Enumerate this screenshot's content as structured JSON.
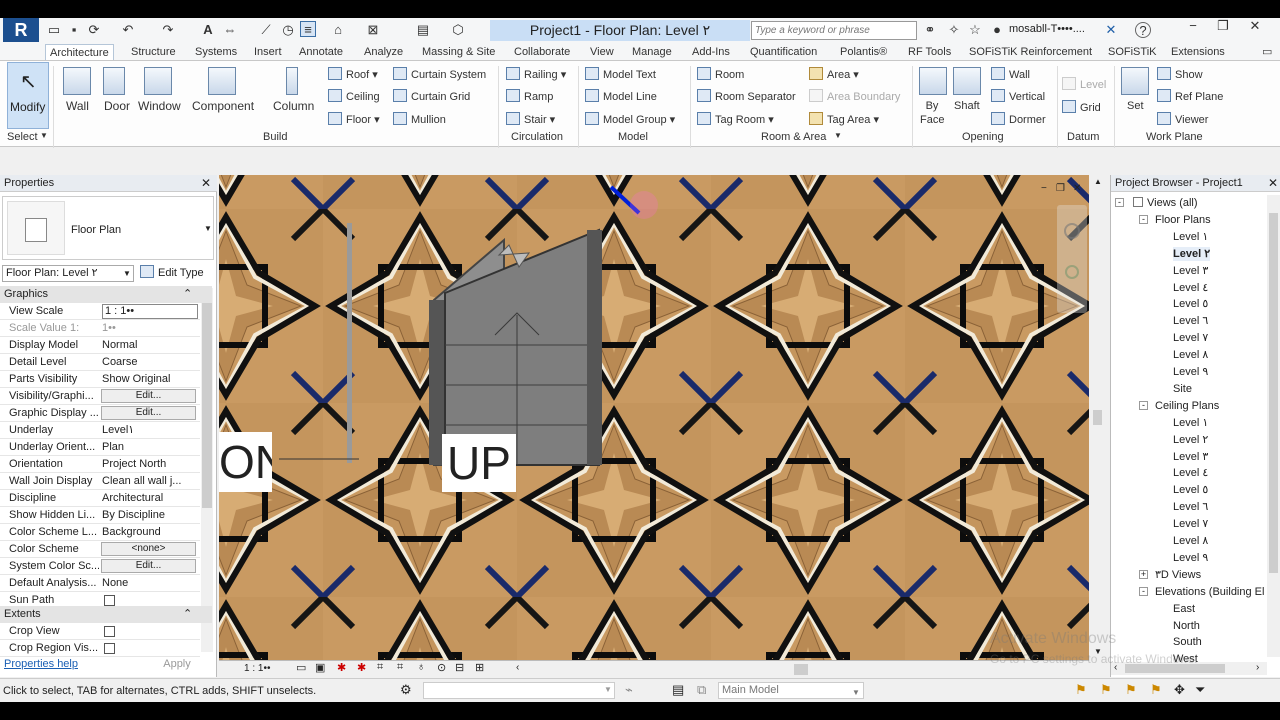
{
  "window": {
    "title": "Project1 - Floor Plan: Level ٢",
    "search_placeholder": "Type a keyword or phrase",
    "user": "mosabll-T••••...."
  },
  "tabs": [
    "Architecture",
    "Structure",
    "Systems",
    "Insert",
    "Annotate",
    "Analyze",
    "Massing & Site",
    "Collaborate",
    "View",
    "Manage",
    "Add-Ins",
    "Quantification",
    "Polantis®",
    "RF Tools",
    "SOFiSTiK Reinforcement",
    "SOFiSTiK",
    "Extensions"
  ],
  "ribbon": {
    "select": {
      "modify": "Modify",
      "select_label": "Select"
    },
    "build": {
      "label": "Build",
      "wall": "Wall",
      "door": "Door",
      "window": "Window",
      "component": "Component",
      "column": "Column",
      "roof": "Roof",
      "ceiling": "Ceiling",
      "floor": "Floor",
      "curtain_system": "Curtain System",
      "curtain_grid": "Curtain Grid",
      "mullion": "Mullion"
    },
    "circulation": {
      "label": "Circulation",
      "railing": "Railing",
      "ramp": "Ramp",
      "stair": "Stair"
    },
    "model": {
      "label": "Model",
      "model_text": "Model Text",
      "model_line": "Model Line",
      "model_group": "Model Group"
    },
    "room_area": {
      "label": "Room & Area",
      "room": "Room",
      "room_separator": "Room Separator",
      "tag_room": "Tag Room",
      "area": "Area",
      "area_boundary": "Area Boundary",
      "tag_area": "Tag Area"
    },
    "opening": {
      "label": "Opening",
      "by_face": "By Face",
      "by_face_2": "Face",
      "by": "By",
      "shaft": "Shaft",
      "wall": "Wall",
      "vertical": "Vertical",
      "dormer": "Dormer"
    },
    "datum": {
      "label": "Datum",
      "level": "Level",
      "grid": "Grid"
    },
    "work_plane": {
      "label": "Work Plane",
      "set": "Set",
      "show": "Show",
      "ref_plane": "Ref Plane",
      "viewer": "Viewer"
    }
  },
  "properties": {
    "title": "Properties",
    "type_name": "Floor Plan",
    "instance": "Floor Plan: Level ٢",
    "edit_type": "Edit Type",
    "groups": {
      "graphics": "Graphics",
      "extents": "Extents"
    },
    "rows": [
      {
        "k": "View Scale",
        "v": "1 : 1••"
      },
      {
        "k": "Scale Value    1:",
        "v": "1••"
      },
      {
        "k": "Display Model",
        "v": "Normal"
      },
      {
        "k": "Detail Level",
        "v": "Coarse"
      },
      {
        "k": "Parts Visibility",
        "v": "Show Original"
      },
      {
        "k": "Visibility/Graphi...",
        "v": "Edit..."
      },
      {
        "k": "Graphic Display ...",
        "v": "Edit..."
      },
      {
        "k": "Underlay",
        "v": "Level١"
      },
      {
        "k": "Underlay Orient...",
        "v": "Plan"
      },
      {
        "k": "Orientation",
        "v": "Project North"
      },
      {
        "k": "Wall Join Display",
        "v": "Clean all wall j..."
      },
      {
        "k": "Discipline",
        "v": "Architectural"
      },
      {
        "k": "Show Hidden Li...",
        "v": "By Discipline"
      },
      {
        "k": "Color Scheme L...",
        "v": "Background"
      },
      {
        "k": "Color Scheme",
        "v": "<none>"
      },
      {
        "k": "System Color Sc...",
        "v": "Edit..."
      },
      {
        "k": "Default Analysis...",
        "v": "None"
      },
      {
        "k": "Sun Path",
        "v": ""
      }
    ],
    "extents_rows": [
      {
        "k": "Crop View",
        "v": ""
      },
      {
        "k": "Crop Region Vis...",
        "v": ""
      }
    ],
    "help": "Properties help",
    "apply": "Apply"
  },
  "canvas": {
    "label_up": "UP",
    "label_dn": "ON",
    "scale": "1 : 1••"
  },
  "browser": {
    "title": "Project Browser - Project1",
    "items": [
      {
        "t": "Views (all)",
        "lvl": 0,
        "exp": "-"
      },
      {
        "t": "Floor Plans",
        "lvl": 1,
        "exp": "-"
      },
      {
        "t": "Level ١",
        "lvl": 2
      },
      {
        "t": "Level ٢",
        "lvl": 2,
        "bold": true
      },
      {
        "t": "Level ٣",
        "lvl": 2
      },
      {
        "t": "Level ٤",
        "lvl": 2
      },
      {
        "t": "Level ٥",
        "lvl": 2
      },
      {
        "t": "Level ٦",
        "lvl": 2
      },
      {
        "t": "Level ٧",
        "lvl": 2
      },
      {
        "t": "Level ٨",
        "lvl": 2
      },
      {
        "t": "Level ٩",
        "lvl": 2
      },
      {
        "t": "Site",
        "lvl": 2
      },
      {
        "t": "Ceiling Plans",
        "lvl": 1,
        "exp": "-"
      },
      {
        "t": "Level ١",
        "lvl": 2
      },
      {
        "t": "Level ٢",
        "lvl": 2
      },
      {
        "t": "Level ٣",
        "lvl": 2
      },
      {
        "t": "Level ٤",
        "lvl": 2
      },
      {
        "t": "Level ٥",
        "lvl": 2
      },
      {
        "t": "Level ٦",
        "lvl": 2
      },
      {
        "t": "Level ٧",
        "lvl": 2
      },
      {
        "t": "Level ٨",
        "lvl": 2
      },
      {
        "t": "Level ٩",
        "lvl": 2
      },
      {
        "t": "٣D Views",
        "lvl": 1,
        "exp": "+"
      },
      {
        "t": "Elevations (Building El",
        "lvl": 1,
        "exp": "-"
      },
      {
        "t": "East",
        "lvl": 2
      },
      {
        "t": "North",
        "lvl": 2
      },
      {
        "t": "South",
        "lvl": 2
      },
      {
        "t": "West",
        "lvl": 2
      }
    ]
  },
  "status": {
    "hint": "Click to select, TAB for alternates, CTRL adds, SHIFT unselects.",
    "model": "Main Model",
    "watermark_1": "Activate Windows",
    "watermark_2": "Go to PC settings to activate Windows."
  },
  "colors": {
    "tile_wood": "#c8995f",
    "tile_border": "#0b0b0b",
    "accent": "#c9def5"
  }
}
